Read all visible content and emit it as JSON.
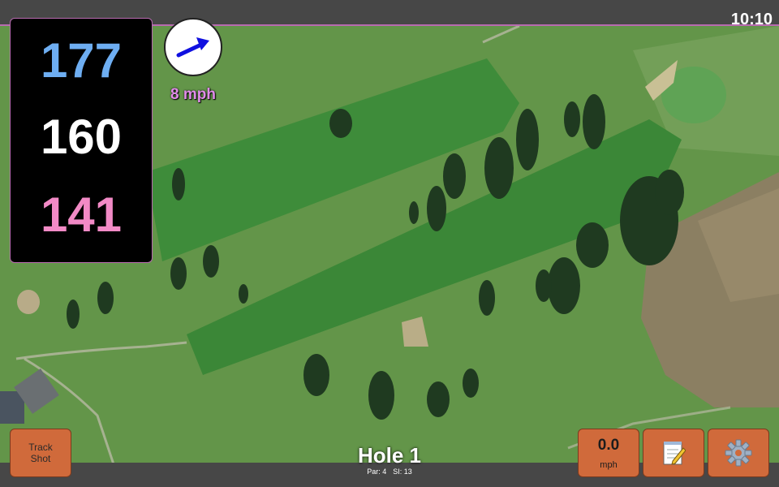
{
  "status": {
    "time": "10:10"
  },
  "distances": {
    "back": "177",
    "middle": "160",
    "front": "141"
  },
  "colors": {
    "back": "#6eaef2",
    "middle": "#ffffff",
    "front": "#f28ac6",
    "accent": "#b86bb0",
    "button": "#d06a3b",
    "wind_arrow": "#1010e0"
  },
  "wind": {
    "icon": "arrow-icon",
    "speed_label": "8 mph"
  },
  "buttons": {
    "track_shot": "Track\nShot",
    "speed_value": "0.0",
    "speed_unit": "mph",
    "scorecard_icon": "notepad-icon",
    "settings_icon": "gear-icon"
  },
  "hole": {
    "title": "Hole 1",
    "par_label": "Par: 4",
    "si_label": "SI: 13"
  }
}
